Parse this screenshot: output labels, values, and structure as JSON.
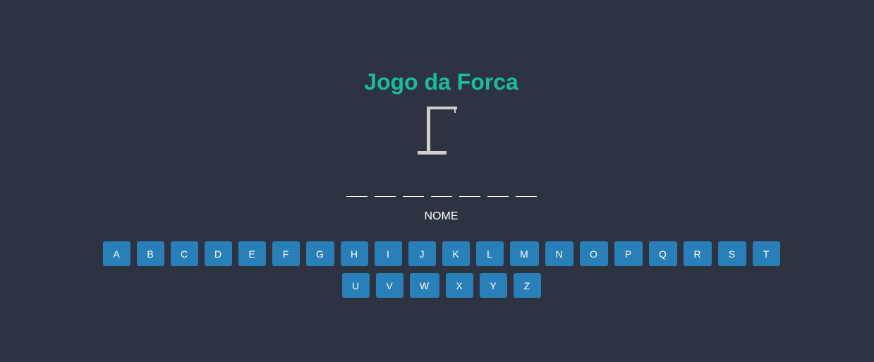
{
  "game": {
    "title": "Jogo da Forca",
    "hint": "NOME",
    "word_length": 7,
    "colors": {
      "background": "#2d3340",
      "title": "#1abc9c",
      "key": "#2980b9",
      "gallows": "#cfcfcf"
    }
  },
  "keyboard": {
    "row1": [
      "A",
      "B",
      "C",
      "D",
      "E",
      "F",
      "G",
      "H",
      "I",
      "J",
      "K",
      "L",
      "M",
      "N",
      "O",
      "P",
      "Q",
      "R",
      "S",
      "T"
    ],
    "row2": [
      "U",
      "V",
      "W",
      "X",
      "Y",
      "Z"
    ]
  }
}
